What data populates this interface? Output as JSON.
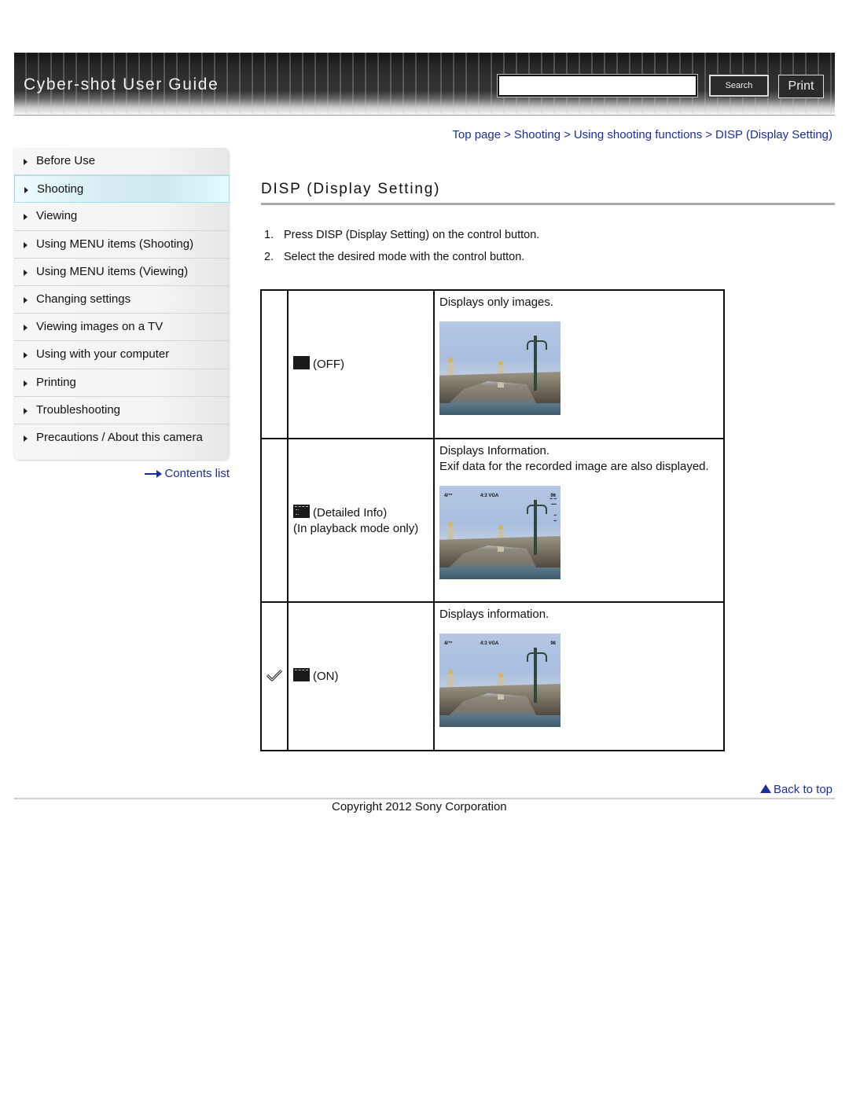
{
  "header": {
    "title": "Cyber-shot User Guide",
    "search": {
      "value": "",
      "placeholder": ""
    },
    "search_button": "Search",
    "print_button": "Print"
  },
  "breadcrumb": [
    {
      "label": "Top page"
    },
    {
      "label": "Shooting"
    },
    {
      "label": "Using shooting functions"
    },
    {
      "label": "DISP (Display Setting)"
    }
  ],
  "breadcrumb_separator": ">",
  "sidebar": {
    "items": [
      {
        "label": "Before Use",
        "active": false
      },
      {
        "label": "Shooting",
        "active": true
      },
      {
        "label": "Viewing",
        "active": false
      },
      {
        "label": "Using MENU items (Shooting)",
        "active": false
      },
      {
        "label": "Using MENU items (Viewing)",
        "active": false
      },
      {
        "label": "Changing settings",
        "active": false
      },
      {
        "label": "Viewing images on a TV",
        "active": false
      },
      {
        "label": "Using with your computer",
        "active": false
      },
      {
        "label": "Printing",
        "active": false
      },
      {
        "label": "Troubleshooting",
        "active": false
      },
      {
        "label": "Precautions / About this camera",
        "active": false
      }
    ],
    "contents_link": "Contents list"
  },
  "main": {
    "title": "DISP (Display Setting)",
    "steps": [
      {
        "num": "1.",
        "text": "Press DISP (Display Setting) on the control button."
      },
      {
        "num": "2.",
        "text": "Select the desired mode with the control button."
      }
    ],
    "table": {
      "rows": [
        {
          "default": false,
          "icon": "display-off-icon",
          "mode_label": "(OFF)",
          "mode_note": "",
          "description": [
            "Displays only images."
          ],
          "image": "bridge-photo-no-overlay"
        },
        {
          "default": false,
          "icon": "display-detailed-info-icon",
          "mode_label": "(Detailed Info)",
          "mode_note": "(In playback mode only)",
          "description": [
            "Displays Information.",
            "Exif data for the recorded image are also displayed."
          ],
          "image": "bridge-photo-detailed-overlay",
          "overlay": {
            "left": "4/™",
            "center": "4:3 VGA",
            "right": "96"
          }
        },
        {
          "default": true,
          "icon": "display-on-icon",
          "mode_label": "(ON)",
          "mode_note": "",
          "description": [
            "Displays information."
          ],
          "image": "bridge-photo-info-overlay",
          "overlay": {
            "left": "4/™",
            "center": "4:3 VGA",
            "right": "96"
          }
        }
      ]
    }
  },
  "footer": {
    "back_to_top": "Back to top",
    "copyright": "Copyright 2012 Sony Corporation"
  },
  "colors": {
    "link": "#1a2e9e",
    "header_bg": "#2c2c2c",
    "active_nav": "#d6eef2"
  }
}
